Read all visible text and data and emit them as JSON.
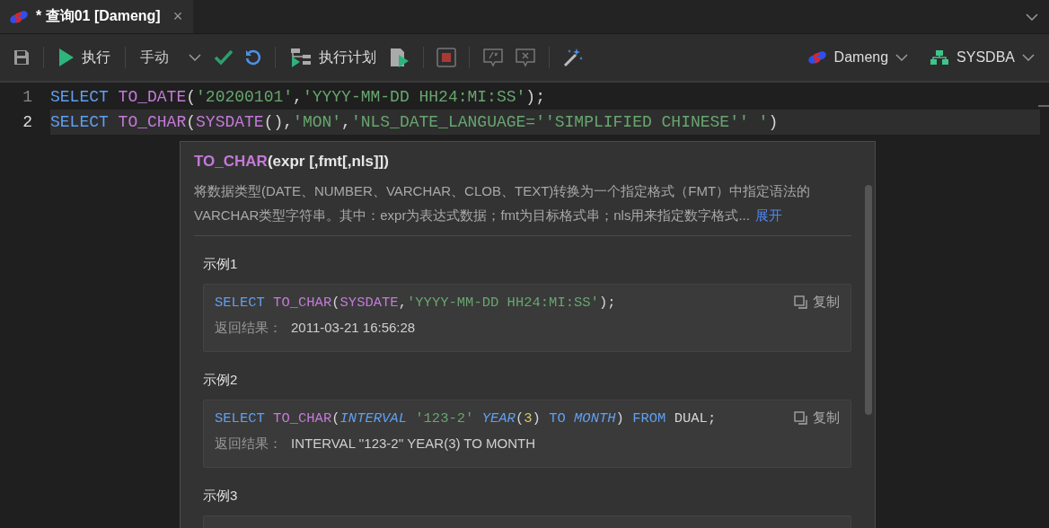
{
  "tabs": [
    {
      "label": "* 查询01 [Dameng]",
      "close": "×",
      "selected": true
    }
  ],
  "toolbar": {
    "run": "执行",
    "mode": "手动",
    "plan": "执行计划"
  },
  "connection": {
    "database": "Dameng",
    "user": "SYSDBA"
  },
  "editor": {
    "lines": [
      {
        "number": "1",
        "current": false,
        "tokens": [
          {
            "kind": "kw",
            "text": "SELECT"
          },
          {
            "kind": "fn",
            "text": " TO_DATE"
          },
          {
            "kind": "p",
            "text": "("
          },
          {
            "kind": "str",
            "text": "'20200101'"
          },
          {
            "kind": "p",
            "text": ","
          },
          {
            "kind": "str",
            "text": "'YYYY-MM-DD HH24:MI:SS'"
          },
          {
            "kind": "p",
            "text": ");"
          }
        ]
      },
      {
        "number": "2",
        "current": true,
        "tokens": [
          {
            "kind": "kw",
            "text": "SELECT"
          },
          {
            "kind": "fn",
            "text": " TO_CHAR"
          },
          {
            "kind": "p",
            "text": "("
          },
          {
            "kind": "fn",
            "text": "SYSDATE"
          },
          {
            "kind": "p",
            "text": "(),"
          },
          {
            "kind": "str",
            "text": "'MON'"
          },
          {
            "kind": "p",
            "text": ","
          },
          {
            "kind": "str",
            "text": "'NLS_DATE_LANGUAGE=''SIMPLIFIED CHINESE'' '"
          },
          {
            "kind": "p",
            "text": ")"
          }
        ]
      }
    ]
  },
  "popup": {
    "title": {
      "name": "TO_CHAR",
      "signature": "(expr [,fmt[,nls]])"
    },
    "description": "将数据类型(DATE、NUMBER、VARCHAR、CLOB、TEXT)转换为一个指定格式（FMT）中指定语法的VARCHAR类型字符串。其中：expr为表达式数据；fmt为目标格式串；nls用来指定数字格式...",
    "expand_link": "展开",
    "examples": [
      {
        "title": "示例1",
        "code": [
          {
            "kind": "kw",
            "text": "SELECT"
          },
          {
            "kind": "fn",
            "text": " TO_CHAR"
          },
          {
            "kind": "p",
            "text": "("
          },
          {
            "kind": "fn",
            "text": "SYSDATE"
          },
          {
            "kind": "p",
            "text": ","
          },
          {
            "kind": "str",
            "text": "'YYYY-MM-DD HH24:MI:SS'"
          },
          {
            "kind": "p",
            "text": ");"
          }
        ],
        "result_label": "返回结果：",
        "result": "2011-03-21 16:56:28",
        "copy": "复制"
      },
      {
        "title": "示例2",
        "code": [
          {
            "kind": "kw",
            "text": "SELECT"
          },
          {
            "kind": "fn",
            "text": " TO_CHAR"
          },
          {
            "kind": "p",
            "text": "("
          },
          {
            "kind": "kwi",
            "text": "INTERVAL"
          },
          {
            "kind": "str",
            "text": " '123-2'"
          },
          {
            "kind": "kwi",
            "text": " YEAR"
          },
          {
            "kind": "p",
            "text": "("
          },
          {
            "kind": "num",
            "text": "3"
          },
          {
            "kind": "p",
            "text": ")"
          },
          {
            "kind": "kw",
            "text": " TO"
          },
          {
            "kind": "kwi",
            "text": " MONTH"
          },
          {
            "kind": "p",
            "text": ")"
          },
          {
            "kind": "kw",
            "text": " FROM"
          },
          {
            "kind": "p",
            "text": " DUAL;"
          }
        ],
        "result_label": "返回结果：",
        "result": "INTERVAL ''123-2'' YEAR(3) TO MONTH",
        "copy": "复制"
      },
      {
        "title": "示例3"
      }
    ]
  }
}
